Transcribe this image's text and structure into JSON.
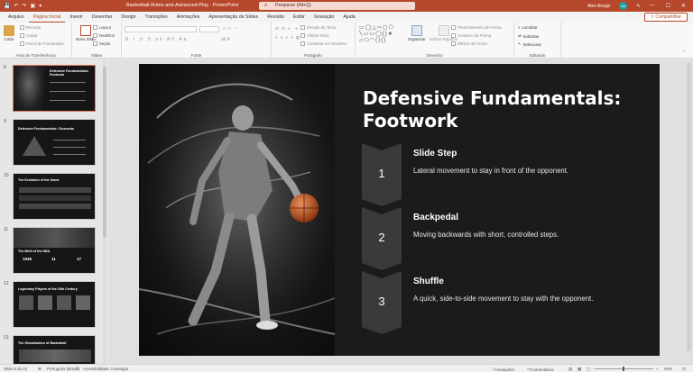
{
  "titlebar": {
    "autosave": "Salvamento automático",
    "document_title": "Basketball-Rules-and-Advanced-Play  -  PowerPoint",
    "search_placeholder": "Pesquisar (Alt+Q)",
    "user_name": "Alex Araujo",
    "user_initials": "AA",
    "minimize": "—",
    "maximize": "☐",
    "close": "✕"
  },
  "tabs": [
    "Arquivo",
    "Página Inicial",
    "Inserir",
    "Desenhar",
    "Design",
    "Transições",
    "Animações",
    "Apresentação de Slides",
    "Revisão",
    "Exibir",
    "Gravação",
    "Ajuda"
  ],
  "active_tab": "Página Inicial",
  "share_label": "Compartilhar",
  "ribbon": {
    "clipboard": {
      "paste": "Colar",
      "cut": "Recortar",
      "copy": "Copiar",
      "format_painter": "Pincel de Formatação",
      "label": "Área de Transferência"
    },
    "slides": {
      "new_slide": "Novo Slide",
      "layout": "Layout",
      "reset": "Redefinir",
      "section": "Seção",
      "label": "Slides"
    },
    "font": {
      "label": "Fonte"
    },
    "paragraph": {
      "text_direction": "Direção do Texto",
      "align_text": "Alinhar Texto",
      "smartart": "Converter em SmartArt",
      "label": "Parágrafo"
    },
    "drawing": {
      "arrange": "Organizar",
      "quick_styles": "Estilos Rápidos",
      "shape_fill": "Preenchimento de Forma",
      "shape_outline": "Contorno da Forma",
      "shape_effects": "Efeitos de Forma",
      "label": "Desenho"
    },
    "editing": {
      "find": "Localizar",
      "replace": "Substituir",
      "select": "Selecionar",
      "label": "Editando"
    }
  },
  "thumbnails": [
    {
      "number": "8",
      "title": "Defensive Fundamentals: Footwork",
      "selected": true
    },
    {
      "number": "9",
      "title": "Defensive Fundamentals: Closeouts",
      "selected": false
    },
    {
      "number": "10",
      "title": "The Evolution of the Game",
      "selected": false
    },
    {
      "number": "11",
      "title": "The Birth of the NBA",
      "selected": false,
      "stats": [
        "1946",
        "11",
        "17"
      ]
    },
    {
      "number": "12",
      "title": "Legendary Players of the 20th Century",
      "selected": false
    },
    {
      "number": "13",
      "title": "The Globalization of Basketball",
      "selected": false
    }
  ],
  "slide": {
    "title_line1": "Defensive Fundamentals:",
    "title_line2": "Footwork",
    "steps": [
      {
        "number": "1",
        "heading": "Slide Step",
        "text": "Lateral movement to stay in front of the opponent."
      },
      {
        "number": "2",
        "heading": "Backpedal",
        "text": "Moving backwards with short, controlled steps."
      },
      {
        "number": "3",
        "heading": "Shuffle",
        "text": "A quick, side-to-side movement to stay with the opponent."
      }
    ],
    "colors": {
      "background": "#1b1b1b",
      "chevron": "#3a3a3a",
      "accent_ball": "#c85a2a"
    }
  },
  "statusbar": {
    "slide_counter": "Slide 8 de 21",
    "language": "Português (Brasil)",
    "accessibility": "Acessibilidade: investigar",
    "notes": "Anotações",
    "comments": "Comentários",
    "zoom": "94%"
  }
}
